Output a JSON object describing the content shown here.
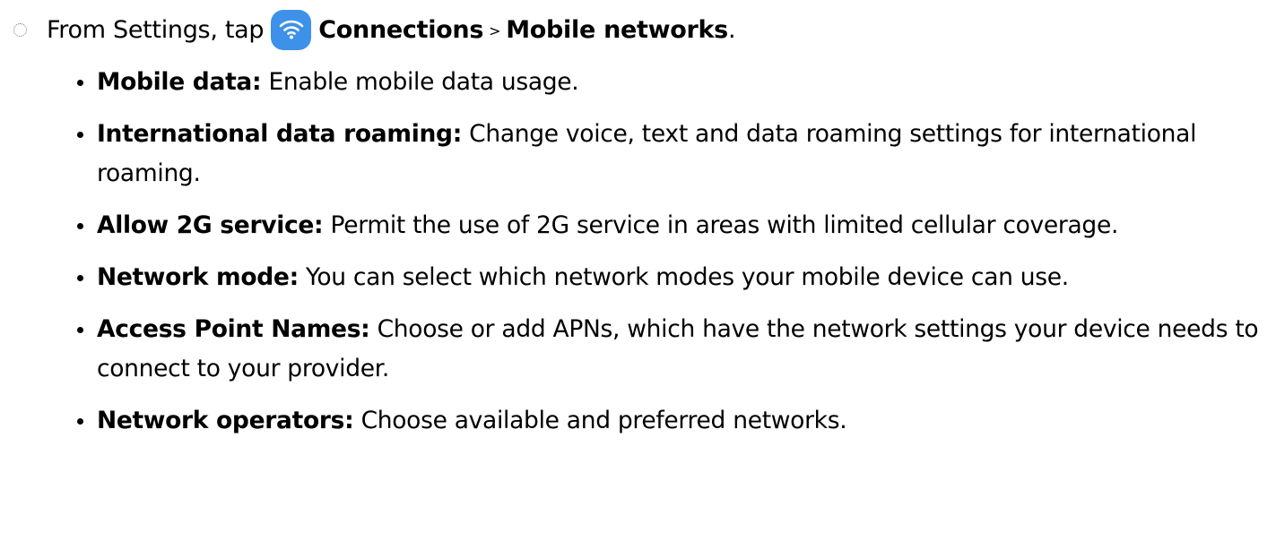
{
  "step": {
    "prefix": "From Settings, tap",
    "icon": "wifi-icon",
    "icon_color": "#3e91e8",
    "link1": "Connections",
    "separator": ">",
    "link2": "Mobile networks",
    "period": "."
  },
  "items": [
    {
      "term": "Mobile data:",
      "description": "Enable mobile data usage."
    },
    {
      "term": "International data roaming:",
      "description": "Change voice, text and data roaming settings for international roaming."
    },
    {
      "term": "Allow 2G service:",
      "description": "Permit the use of 2G service in areas with limited cellular coverage."
    },
    {
      "term": "Network mode:",
      "description": "You can select which network modes your mobile device can use."
    },
    {
      "term": "Access Point Names:",
      "description": "Choose or add APNs, which have the network settings your device needs to connect to your provider."
    },
    {
      "term": "Network operators:",
      "description": "Choose available and preferred networks."
    }
  ]
}
